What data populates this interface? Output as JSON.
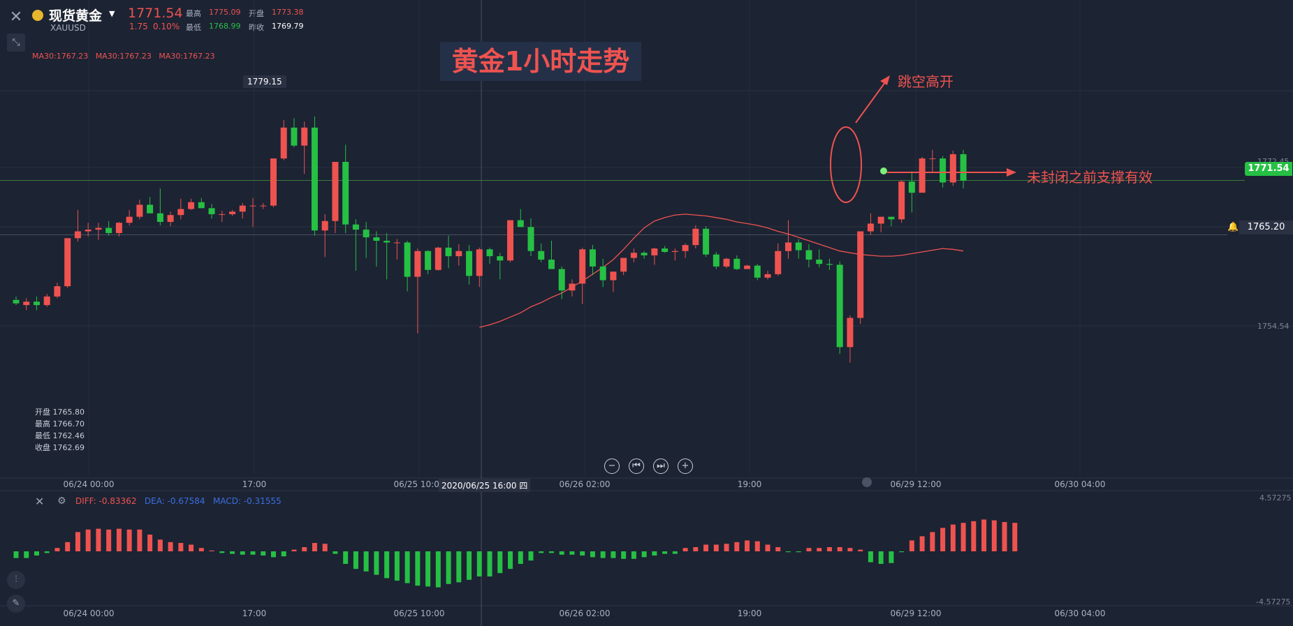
{
  "header": {
    "symbol_name": "现货黄金",
    "symbol_code": "XAUUSD",
    "price": "1771.54",
    "change": "1.75",
    "change_pct": "0.10%",
    "high_label": "最高",
    "high_value": "1775.09",
    "open_label": "开盘",
    "open_value": "1773.38",
    "low_label": "最低",
    "low_value": "1768.99",
    "prev_close_label": "昨收",
    "prev_close_value": "1769.79"
  },
  "ma_legend": "MA30:1767.23   MA30:1767.23   MA30:1767.23",
  "title": "黄金1小时走势",
  "peak_label": "1779.15",
  "ohlc_readout": {
    "open": "开盘 1765.80",
    "high": "最高 1766.70",
    "low": "最低 1762.46",
    "close": "收盘 1762.69"
  },
  "price_tags": {
    "current": "1771.54",
    "alert": "1765.20",
    "y_1772": "1772.45",
    "y_1754": "1754.54"
  },
  "annotations": {
    "gap_up": "跳空高开",
    "support": "未封闭之前支撑有效"
  },
  "x_ticks": [
    "06/24 00:00",
    "17:00",
    "06/25 10:00",
    "06/26 02:00",
    "19:00",
    "06/29 12:00",
    "06/30 04:00"
  ],
  "crosshair_time": "2020/06/25 16:00 四",
  "macd": {
    "diff": "DIFF: -0.83362",
    "dea": "DEA: -0.67584",
    "macd": "MACD: -0.31555",
    "y_top": "4.57275",
    "y_bottom": "-4.57275"
  },
  "colors": {
    "up": "#ef5350",
    "down": "#26c044",
    "background": "#1c2333",
    "ma": "#ef5350",
    "dea": "#3b6fe0"
  },
  "chart_data": {
    "type": "candlestick",
    "title": "黄金1小时走势",
    "ylim": [
      1747,
      1782
    ],
    "candles": [
      {
        "o": 1757.6,
        "h": 1758.0,
        "l": 1757.0,
        "c": 1757.2
      },
      {
        "o": 1757.0,
        "h": 1757.8,
        "l": 1756.4,
        "c": 1757.4
      },
      {
        "o": 1757.4,
        "h": 1758.0,
        "l": 1756.4,
        "c": 1757.0
      },
      {
        "o": 1757.0,
        "h": 1758.3,
        "l": 1756.8,
        "c": 1758.0
      },
      {
        "o": 1758.0,
        "h": 1759.6,
        "l": 1757.8,
        "c": 1759.2
      },
      {
        "o": 1759.2,
        "h": 1764.8,
        "l": 1759.0,
        "c": 1764.8
      },
      {
        "o": 1764.8,
        "h": 1768.1,
        "l": 1764.4,
        "c": 1765.6
      },
      {
        "o": 1765.6,
        "h": 1766.6,
        "l": 1765.0,
        "c": 1765.8
      },
      {
        "o": 1765.8,
        "h": 1766.6,
        "l": 1764.6,
        "c": 1766.0
      },
      {
        "o": 1766.0,
        "h": 1766.8,
        "l": 1765.1,
        "c": 1765.4
      },
      {
        "o": 1765.4,
        "h": 1766.7,
        "l": 1765.0,
        "c": 1766.6
      },
      {
        "o": 1766.6,
        "h": 1768.1,
        "l": 1766.3,
        "c": 1767.3
      },
      {
        "o": 1767.3,
        "h": 1769.3,
        "l": 1767.0,
        "c": 1768.7
      },
      {
        "o": 1768.7,
        "h": 1769.6,
        "l": 1767.8,
        "c": 1767.7
      },
      {
        "o": 1767.7,
        "h": 1770.6,
        "l": 1766.3,
        "c": 1766.7
      },
      {
        "o": 1766.7,
        "h": 1767.9,
        "l": 1766.2,
        "c": 1767.5
      },
      {
        "o": 1767.5,
        "h": 1769.4,
        "l": 1767.0,
        "c": 1768.2
      },
      {
        "o": 1768.2,
        "h": 1769.4,
        "l": 1768.1,
        "c": 1769.0
      },
      {
        "o": 1769.0,
        "h": 1769.5,
        "l": 1768.3,
        "c": 1768.3
      },
      {
        "o": 1768.3,
        "h": 1768.8,
        "l": 1767.1,
        "c": 1767.6
      },
      {
        "o": 1767.6,
        "h": 1768.0,
        "l": 1766.7,
        "c": 1767.6
      },
      {
        "o": 1767.6,
        "h": 1768.1,
        "l": 1767.4,
        "c": 1767.9
      },
      {
        "o": 1767.9,
        "h": 1768.9,
        "l": 1767.1,
        "c": 1768.6
      },
      {
        "o": 1768.6,
        "h": 1769.5,
        "l": 1766.1,
        "c": 1768.6
      },
      {
        "o": 1768.6,
        "h": 1768.9,
        "l": 1768.2,
        "c": 1768.6
      },
      {
        "o": 1768.6,
        "h": 1774.1,
        "l": 1768.4,
        "c": 1774.1
      },
      {
        "o": 1774.1,
        "h": 1778.6,
        "l": 1773.9,
        "c": 1777.7
      },
      {
        "o": 1777.7,
        "h": 1778.8,
        "l": 1775.4,
        "c": 1775.6
      },
      {
        "o": 1775.6,
        "h": 1778.4,
        "l": 1772.3,
        "c": 1777.7
      },
      {
        "o": 1777.7,
        "h": 1779.0,
        "l": 1765.1,
        "c": 1765.7
      },
      {
        "o": 1765.7,
        "h": 1767.6,
        "l": 1762.6,
        "c": 1766.8
      },
      {
        "o": 1766.8,
        "h": 1773.7,
        "l": 1765.4,
        "c": 1773.7
      },
      {
        "o": 1773.7,
        "h": 1775.7,
        "l": 1765.4,
        "c": 1766.4
      },
      {
        "o": 1766.4,
        "h": 1767.0,
        "l": 1761.0,
        "c": 1765.8
      },
      {
        "o": 1765.8,
        "h": 1766.7,
        "l": 1762.5,
        "c": 1764.9
      },
      {
        "o": 1764.9,
        "h": 1765.6,
        "l": 1761.5,
        "c": 1764.5
      },
      {
        "o": 1764.5,
        "h": 1765.4,
        "l": 1760.0,
        "c": 1764.3
      },
      {
        "o": 1764.3,
        "h": 1764.7,
        "l": 1762.3,
        "c": 1764.3
      },
      {
        "o": 1764.3,
        "h": 1764.5,
        "l": 1758.6,
        "c": 1760.3
      },
      {
        "o": 1760.3,
        "h": 1763.6,
        "l": 1753.7,
        "c": 1763.3
      },
      {
        "o": 1763.3,
        "h": 1763.4,
        "l": 1760.6,
        "c": 1761.1
      },
      {
        "o": 1761.1,
        "h": 1763.8,
        "l": 1761.0,
        "c": 1763.7
      },
      {
        "o": 1763.7,
        "h": 1765.1,
        "l": 1761.3,
        "c": 1762.7
      },
      {
        "o": 1762.7,
        "h": 1764.1,
        "l": 1761.6,
        "c": 1763.3
      },
      {
        "o": 1763.3,
        "h": 1764.0,
        "l": 1759.4,
        "c": 1760.4
      },
      {
        "o": 1760.4,
        "h": 1763.7,
        "l": 1759.1,
        "c": 1763.5
      },
      {
        "o": 1763.5,
        "h": 1763.7,
        "l": 1761.8,
        "c": 1762.7
      },
      {
        "o": 1762.7,
        "h": 1763.1,
        "l": 1760.0,
        "c": 1762.2
      },
      {
        "o": 1762.2,
        "h": 1766.9,
        "l": 1762.0,
        "c": 1766.9
      },
      {
        "o": 1766.9,
        "h": 1768.2,
        "l": 1766.4,
        "c": 1766.1
      },
      {
        "o": 1766.1,
        "h": 1767.1,
        "l": 1762.7,
        "c": 1763.3
      },
      {
        "o": 1763.3,
        "h": 1764.2,
        "l": 1762.0,
        "c": 1762.3
      },
      {
        "o": 1762.3,
        "h": 1764.5,
        "l": 1761.7,
        "c": 1761.2
      },
      {
        "o": 1761.2,
        "h": 1761.5,
        "l": 1757.7,
        "c": 1758.7
      },
      {
        "o": 1758.7,
        "h": 1760.0,
        "l": 1758.0,
        "c": 1759.5
      },
      {
        "o": 1759.5,
        "h": 1763.7,
        "l": 1757.1,
        "c": 1763.5
      },
      {
        "o": 1763.5,
        "h": 1764.0,
        "l": 1760.5,
        "c": 1761.5
      },
      {
        "o": 1761.5,
        "h": 1762.4,
        "l": 1759.1,
        "c": 1759.9
      },
      {
        "o": 1759.9,
        "h": 1760.9,
        "l": 1758.5,
        "c": 1760.9
      },
      {
        "o": 1760.9,
        "h": 1762.2,
        "l": 1760.5,
        "c": 1762.5
      },
      {
        "o": 1762.5,
        "h": 1763.6,
        "l": 1762.0,
        "c": 1763.1
      },
      {
        "o": 1763.1,
        "h": 1763.3,
        "l": 1762.4,
        "c": 1762.8
      },
      {
        "o": 1762.8,
        "h": 1763.7,
        "l": 1761.7,
        "c": 1763.6
      },
      {
        "o": 1763.6,
        "h": 1763.9,
        "l": 1763.1,
        "c": 1763.2
      },
      {
        "o": 1763.2,
        "h": 1763.6,
        "l": 1762.2,
        "c": 1763.3
      },
      {
        "o": 1763.3,
        "h": 1764.2,
        "l": 1762.5,
        "c": 1764.0
      },
      {
        "o": 1764.0,
        "h": 1766.3,
        "l": 1763.6,
        "c": 1765.9
      },
      {
        "o": 1765.9,
        "h": 1766.2,
        "l": 1762.6,
        "c": 1762.9
      },
      {
        "o": 1762.9,
        "h": 1763.2,
        "l": 1761.2,
        "c": 1761.5
      },
      {
        "o": 1761.5,
        "h": 1762.5,
        "l": 1761.3,
        "c": 1762.4
      },
      {
        "o": 1762.4,
        "h": 1762.8,
        "l": 1761.1,
        "c": 1761.2
      },
      {
        "o": 1761.2,
        "h": 1761.7,
        "l": 1761.2,
        "c": 1761.6
      },
      {
        "o": 1761.6,
        "h": 1761.8,
        "l": 1759.9,
        "c": 1760.2
      },
      {
        "o": 1760.2,
        "h": 1761.0,
        "l": 1760.0,
        "c": 1760.6
      },
      {
        "o": 1760.6,
        "h": 1764.2,
        "l": 1760.4,
        "c": 1763.3
      },
      {
        "o": 1763.3,
        "h": 1766.9,
        "l": 1762.4,
        "c": 1764.3
      },
      {
        "o": 1764.3,
        "h": 1764.7,
        "l": 1762.4,
        "c": 1763.4
      },
      {
        "o": 1763.4,
        "h": 1764.1,
        "l": 1761.4,
        "c": 1762.3
      },
      {
        "o": 1762.3,
        "h": 1763.5,
        "l": 1761.4,
        "c": 1761.8
      },
      {
        "o": 1761.8,
        "h": 1762.4,
        "l": 1761.1,
        "c": 1761.7
      },
      {
        "o": 1761.7,
        "h": 1762.1,
        "l": 1751.3,
        "c": 1752.1
      },
      {
        "o": 1752.1,
        "h": 1755.8,
        "l": 1750.3,
        "c": 1755.5
      },
      {
        "o": 1755.5,
        "h": 1765.6,
        "l": 1754.8,
        "c": 1765.6
      },
      {
        "o": 1765.6,
        "h": 1767.7,
        "l": 1765.2,
        "c": 1766.5
      },
      {
        "o": 1766.5,
        "h": 1767.2,
        "l": 1765.5,
        "c": 1767.3
      },
      {
        "o": 1767.3,
        "h": 1767.3,
        "l": 1766.2,
        "c": 1767.0
      },
      {
        "o": 1767.0,
        "h": 1771.6,
        "l": 1766.6,
        "c": 1771.4
      },
      {
        "o": 1771.4,
        "h": 1772.6,
        "l": 1767.8,
        "c": 1770.1
      },
      {
        "o": 1770.1,
        "h": 1774.3,
        "l": 1770.4,
        "c": 1774.1
      },
      {
        "o": 1774.1,
        "h": 1775.1,
        "l": 1772.5,
        "c": 1774.1
      },
      {
        "o": 1774.1,
        "h": 1774.4,
        "l": 1770.7,
        "c": 1771.3
      },
      {
        "o": 1771.3,
        "h": 1775.0,
        "l": 1770.9,
        "c": 1774.6
      },
      {
        "o": 1774.6,
        "h": 1775.1,
        "l": 1770.6,
        "c": 1771.5
      }
    ],
    "ma30": [
      1754.4,
      1754.7,
      1755.1,
      1755.6,
      1756.1,
      1756.8,
      1757.3,
      1757.9,
      1758.4,
      1759.1,
      1759.8,
      1760.6,
      1761.4,
      1762.3,
      1763.5,
      1764.8,
      1766.0,
      1766.8,
      1767.2,
      1767.5,
      1767.6,
      1767.5,
      1767.4,
      1767.2,
      1767.0,
      1766.7,
      1766.5,
      1766.3,
      1766.0,
      1765.6,
      1765.3,
      1764.9,
      1764.5,
      1764.1,
      1763.7,
      1763.3,
      1763.1,
      1762.9,
      1762.8,
      1762.7,
      1762.7,
      1762.8,
      1763.0,
      1763.2,
      1763.4,
      1763.6,
      1763.5,
      1763.3
    ],
    "macd_hist": [
      -0.8,
      -0.8,
      -0.5,
      -0.2,
      0.4,
      1.1,
      2.3,
      2.6,
      2.7,
      2.6,
      2.7,
      2.6,
      2.6,
      2.0,
      1.4,
      1.1,
      1.0,
      0.8,
      0.4,
      0.1,
      -0.2,
      -0.3,
      -0.4,
      -0.4,
      -0.5,
      -0.7,
      -0.6,
      0.2,
      0.5,
      1.0,
      0.9,
      -0.3,
      -1.5,
      -2.1,
      -2.4,
      -2.8,
      -3.2,
      -3.5,
      -3.8,
      -4.1,
      -4.2,
      -4.3,
      -3.9,
      -3.7,
      -3.4,
      -3.0,
      -3.0,
      -2.6,
      -2.1,
      -1.5,
      -1.1,
      -0.2,
      -0.2,
      -0.4,
      -0.4,
      -0.5,
      -0.7,
      -0.8,
      -0.8,
      -0.9,
      -0.9,
      -0.7,
      -0.5,
      -0.3,
      -0.3,
      0.4,
      0.5,
      0.8,
      0.8,
      0.9,
      1.1,
      1.3,
      1.2,
      0.8,
      0.5,
      -0.1,
      -0.1,
      0.4,
      0.4,
      0.5,
      0.5,
      0.4,
      0.2,
      -1.3,
      -1.5,
      -1.4,
      -0.1,
      1.3,
      1.8,
      2.3,
      2.8,
      3.2,
      3.4,
      3.6,
      3.8,
      3.7,
      3.5,
      3.4
    ]
  }
}
